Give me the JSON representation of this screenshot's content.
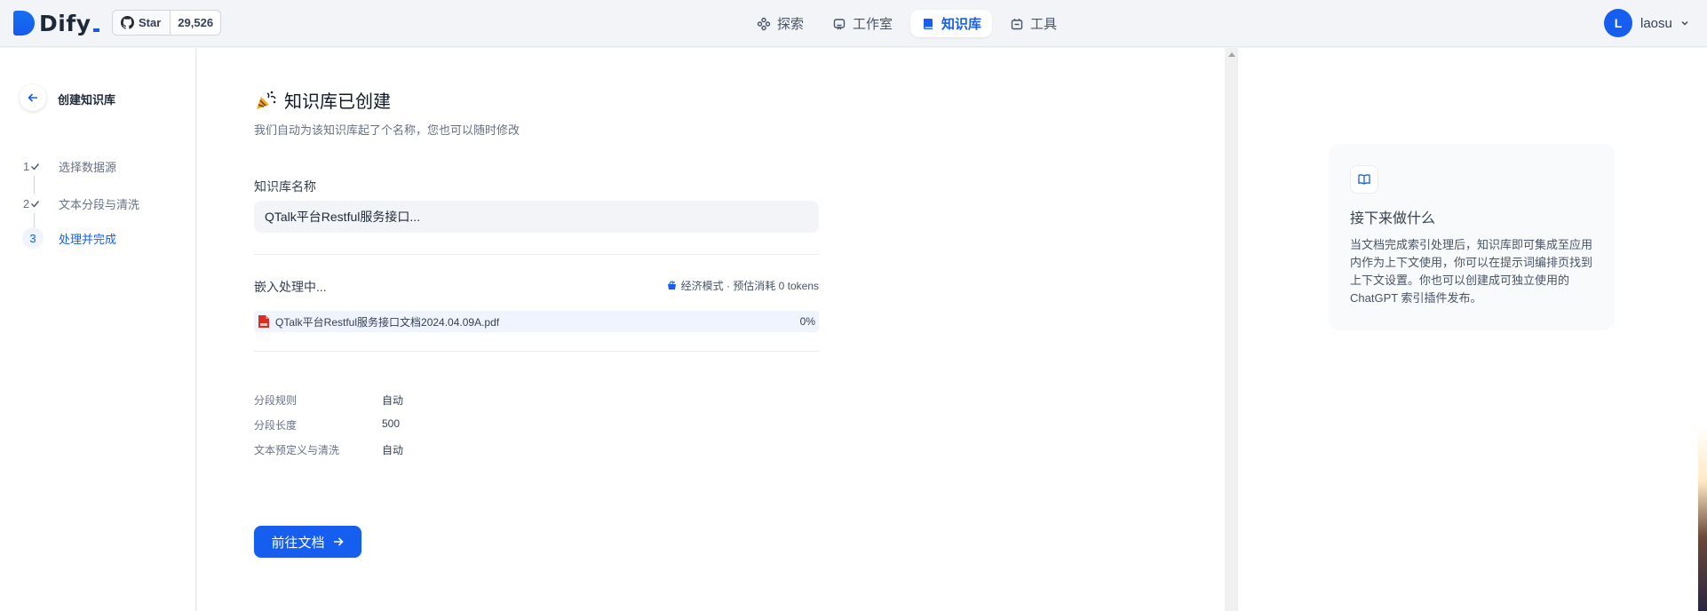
{
  "header": {
    "logo_text": "Dify",
    "github": {
      "star_label": "Star",
      "count": "29,526"
    },
    "nav": [
      {
        "label": "探索",
        "icon": "explore-icon",
        "active": false
      },
      {
        "label": "工作室",
        "icon": "robot-icon",
        "active": false
      },
      {
        "label": "知识库",
        "icon": "book-icon",
        "active": true
      },
      {
        "label": "工具",
        "icon": "tool-icon",
        "active": false
      }
    ],
    "user": {
      "initial": "L",
      "name": "laosu"
    }
  },
  "sidebar": {
    "title": "创建知识库",
    "steps": [
      {
        "num": "1",
        "label": "选择数据源",
        "done": true
      },
      {
        "num": "2",
        "label": "文本分段与清洗",
        "done": true
      },
      {
        "num": "3",
        "label": "处理并完成",
        "current": true
      }
    ]
  },
  "main": {
    "title": "知识库已创建",
    "subtitle": "我们自动为该知识库起了个名称，您也可以随时修改",
    "name_label": "知识库名称",
    "name_value": "QTalk平台Restful服务接口...",
    "embed_title": "嵌入处理中...",
    "embed_meta": "经济模式 · 预估消耗 0 tokens",
    "file": {
      "name": "QTalk平台Restful服务接口文档2024.04.09A.pdf",
      "progress": "0%"
    },
    "rules": [
      {
        "label": "分段规则",
        "value": "自动"
      },
      {
        "label": "分段长度",
        "value": "500"
      },
      {
        "label": "文本预定义与清洗",
        "value": "自动"
      }
    ],
    "go_button": "前往文档"
  },
  "next": {
    "title": "接下来做什么",
    "text": "当文档完成索引处理后，知识库即可集成至应用内作为上下文使用，你可以在提示词编排页找到上下文设置。你也可以创建成可独立使用的 ChatGPT 索引插件发布。"
  },
  "colors": {
    "accent": "#155eef",
    "bg": "#f2f4f7"
  }
}
